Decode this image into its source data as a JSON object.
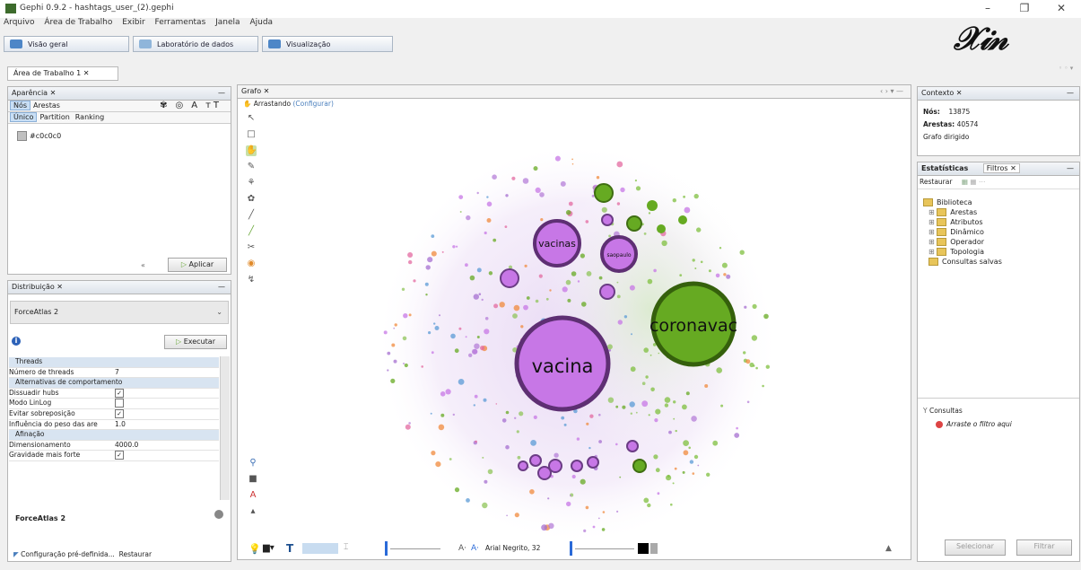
{
  "window": {
    "title": "Gephi 0.9.2 - hashtags_user_(2).gephi",
    "minimize_glyph": "–",
    "restore_glyph": "❐",
    "close_glyph": "✕"
  },
  "menu": [
    "Arquivo",
    "Área de Trabalho",
    "Exibir",
    "Ferramentas",
    "Janela",
    "Ajuda"
  ],
  "modes": [
    "Visão geral",
    "Laboratório de dados",
    "Visualização"
  ],
  "logo_text": "ℰℐ𝓃",
  "workspace_tab": "Área de Trabalho 1  ✕",
  "appearance": {
    "title": "Aparência ✕",
    "tabs": [
      "Nós",
      "Arestas"
    ],
    "subtabs": [
      "Único",
      "Partition",
      "Ranking"
    ],
    "color_value": "#c0c0c0",
    "apply_label": "Aplicar"
  },
  "layout": {
    "title": "Distribuição ✕",
    "algorithm": "ForceAtlas 2",
    "run_label": "Executar",
    "rows": [
      {
        "type": "cat",
        "label": "Threads"
      },
      {
        "type": "val",
        "label": "Número de threads",
        "value": "7"
      },
      {
        "type": "cat",
        "label": "Alternativas de comportamento"
      },
      {
        "type": "chk",
        "label": "Dissuadir hubs",
        "value": "✓"
      },
      {
        "type": "chk",
        "label": "Modo LinLog",
        "value": ""
      },
      {
        "type": "chk",
        "label": "Evitar sobreposição",
        "value": "✓"
      },
      {
        "type": "val",
        "label": "Influência do peso das are",
        "value": "1.0"
      },
      {
        "type": "cat",
        "label": "Afinação"
      },
      {
        "type": "val",
        "label": "Dimensionamento",
        "value": "4000.0"
      },
      {
        "type": "chk",
        "label": "Gravidade mais forte",
        "value": "✓"
      }
    ],
    "footer_title": "ForceAtlas 2",
    "preset_label": "Configuração pré-definida...",
    "reset_label": "Restaurar"
  },
  "graph": {
    "tab_title": "Grafo ✕",
    "drag_label": "Arrastando",
    "configure_label": "(Configurar)",
    "big_nodes": [
      "vacina",
      "coronavac",
      "vacinas",
      "saopaulo"
    ]
  },
  "context": {
    "title": "Contexto ✕",
    "nodes_label": "Nós:",
    "nodes_value": "13875",
    "edges_label": "Arestas:",
    "edges_value": "40574",
    "graph_type": "Grafo dirigido"
  },
  "filters": {
    "tabs": [
      "Estatísticas",
      "Filtros ✕"
    ],
    "reset_label": "Restaurar",
    "tree": [
      "Biblioteca",
      "Arestas",
      "Atributos",
      "Dinâmico",
      "Operador",
      "Topologia",
      "Consultas salvas"
    ],
    "queries_label": "Consultas",
    "drag_hint": "Arraste o filtro aqui",
    "select_label": "Selecionar",
    "filter_label": "Filtrar"
  },
  "bottombar": {
    "font_label": "Arial Negrito, 32"
  }
}
